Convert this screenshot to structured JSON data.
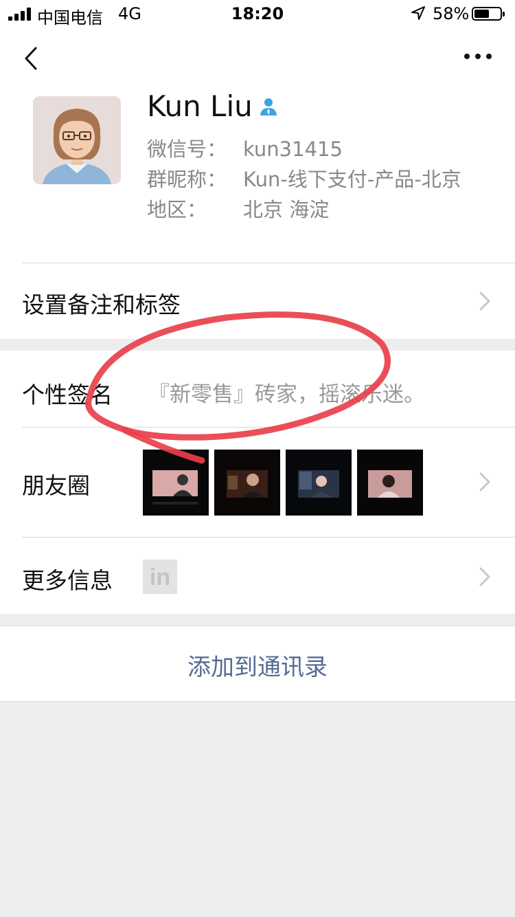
{
  "status_bar": {
    "carrier": "中国电信",
    "network": "4G",
    "time": "18:20",
    "battery_percent": "58%",
    "battery_level": 0.58
  },
  "nav": {
    "back_icon": "chevron-left-icon",
    "more_icon": "ellipsis-icon"
  },
  "profile": {
    "name": "Kun Liu",
    "wechat_id_label": "微信号：",
    "wechat_id": "kun31415",
    "group_nick_label": "群昵称：",
    "group_nick": "Kun-线下支付-产品-北京",
    "region_label": "地区：",
    "region": "北京 海淀"
  },
  "rows": {
    "remark_tags": "设置备注和标签",
    "signature_label": "个性签名",
    "signature_value": "『新零售』砖家，摇滚乐迷。",
    "moments_label": "朋友圈",
    "more_info_label": "更多信息",
    "linkedin_text": "in"
  },
  "actions": {
    "add_contact": "添加到通讯录"
  },
  "colors": {
    "link_blue": "#576b95",
    "annotation_red": "#e8404a",
    "user_icon_blue": "#3aa3e0"
  }
}
